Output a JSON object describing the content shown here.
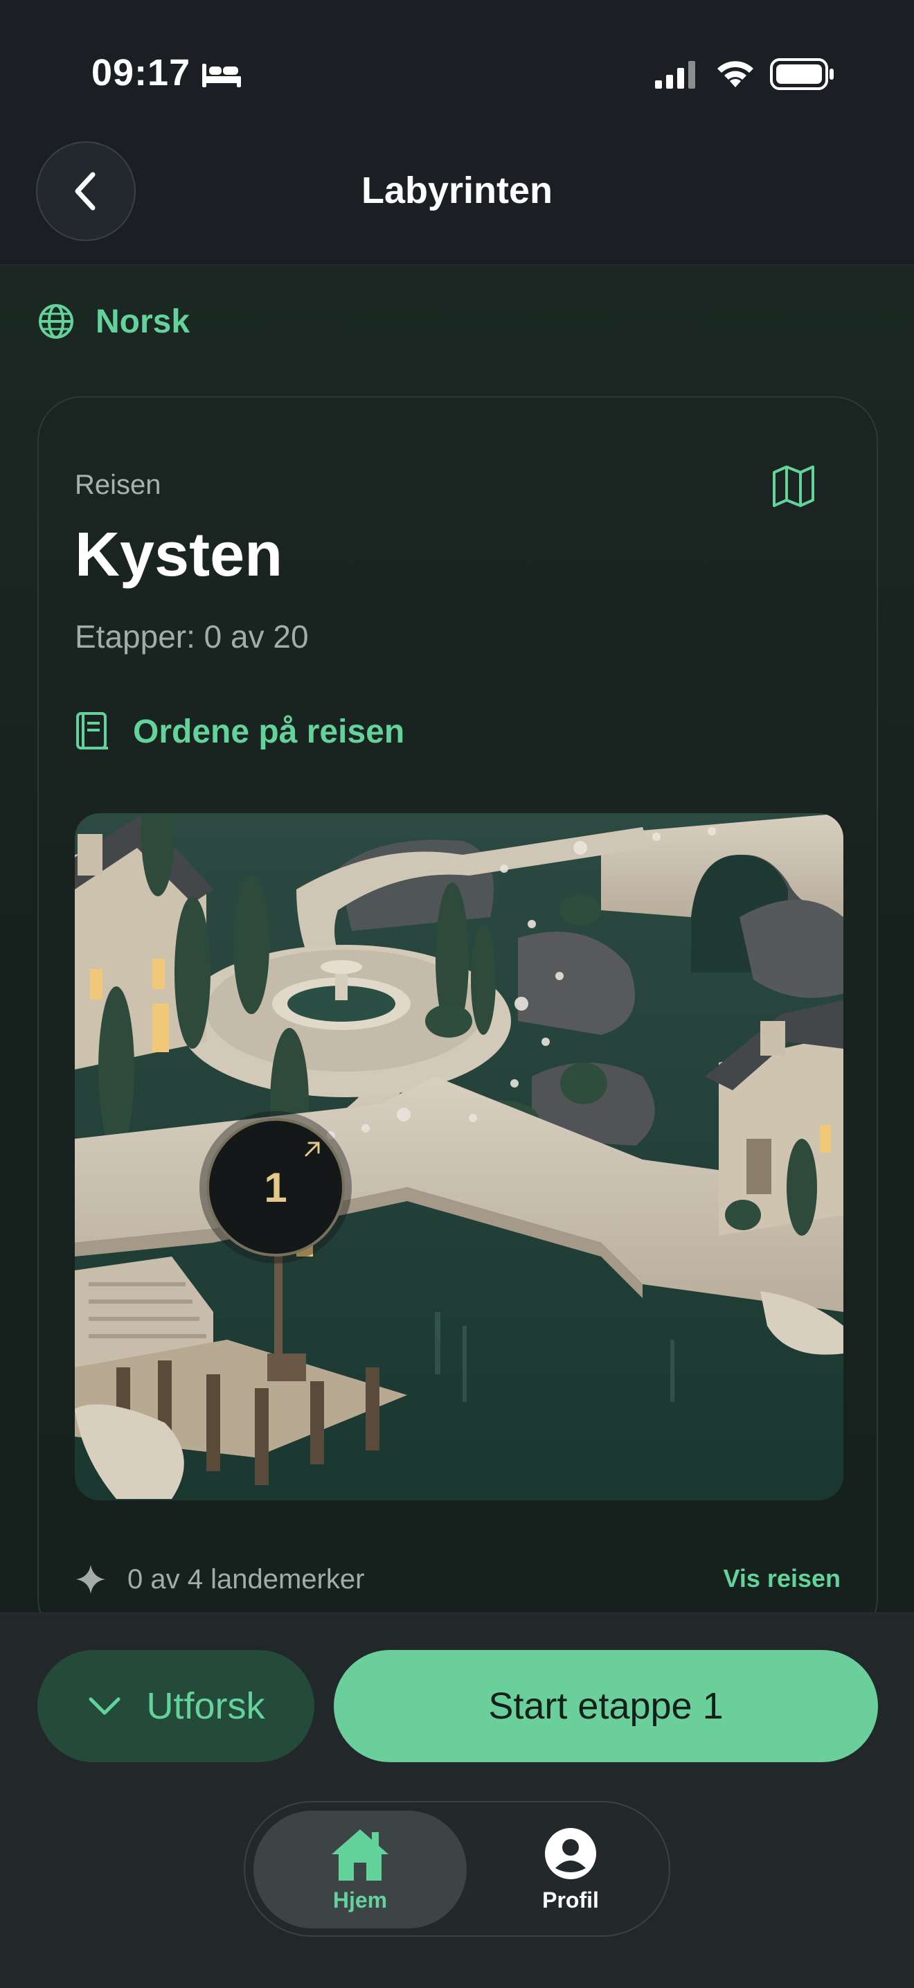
{
  "status_bar": {
    "time": "09:17",
    "icons": [
      "bed-icon",
      "signal-icon",
      "wifi-icon",
      "battery-icon"
    ]
  },
  "header": {
    "title": "Labyrinten",
    "back_icon": "chevron-left-icon"
  },
  "language": {
    "label": "Norsk",
    "icon": "globe-icon"
  },
  "journey_card": {
    "eyebrow": "Reisen",
    "title": "Kysten",
    "progress": "Etapper: 0 av 20",
    "map_icon": "map-icon",
    "words_link": "Ordene på reisen",
    "words_icon": "book-icon",
    "current_stage": "1",
    "landmarks": "0 av 4 landemerker",
    "show_journey": "Vis reisen"
  },
  "actions": {
    "explore_label": "Utforsk",
    "start_label": "Start etappe 1"
  },
  "tabbar": {
    "home_label": "Hjem",
    "profile_label": "Profil"
  },
  "colors": {
    "accent": "#63d39b",
    "primary_button": "#6bcf9c",
    "background": "#17221e",
    "header": "#1b1e22"
  }
}
